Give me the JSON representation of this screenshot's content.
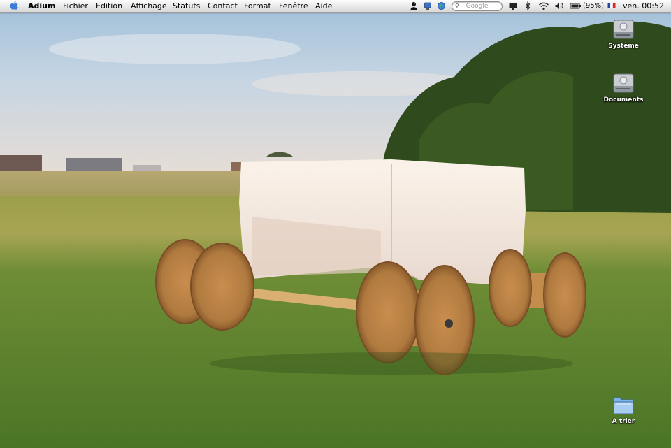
{
  "menubar": {
    "apple_icon": "apple-icon",
    "app_name": "Adium",
    "items": [
      "Fichier",
      "Edition",
      "Affichage",
      "Statuts",
      "Contact",
      "Format",
      "Fenêtre",
      "Aide"
    ],
    "search_placeholder": "Google",
    "battery_text": "(95%)",
    "clock": "ven. 00:52",
    "tray_icons": [
      "adium-duck-icon",
      "display-icon",
      "globe-icon",
      "search-icon",
      "screen-icon",
      "bluetooth-icon",
      "wifi-icon",
      "volume-icon",
      "battery-icon",
      "flag-fr-icon"
    ]
  },
  "desktop": {
    "icons": [
      {
        "label": "Système",
        "type": "hard-drive-icon"
      },
      {
        "label": "Documents",
        "type": "hard-drive-icon"
      },
      {
        "label": "A trier",
        "type": "folder-icon"
      }
    ],
    "wallpaper": "Field at sunset with a cloth-covered wagon built from cable reels"
  }
}
